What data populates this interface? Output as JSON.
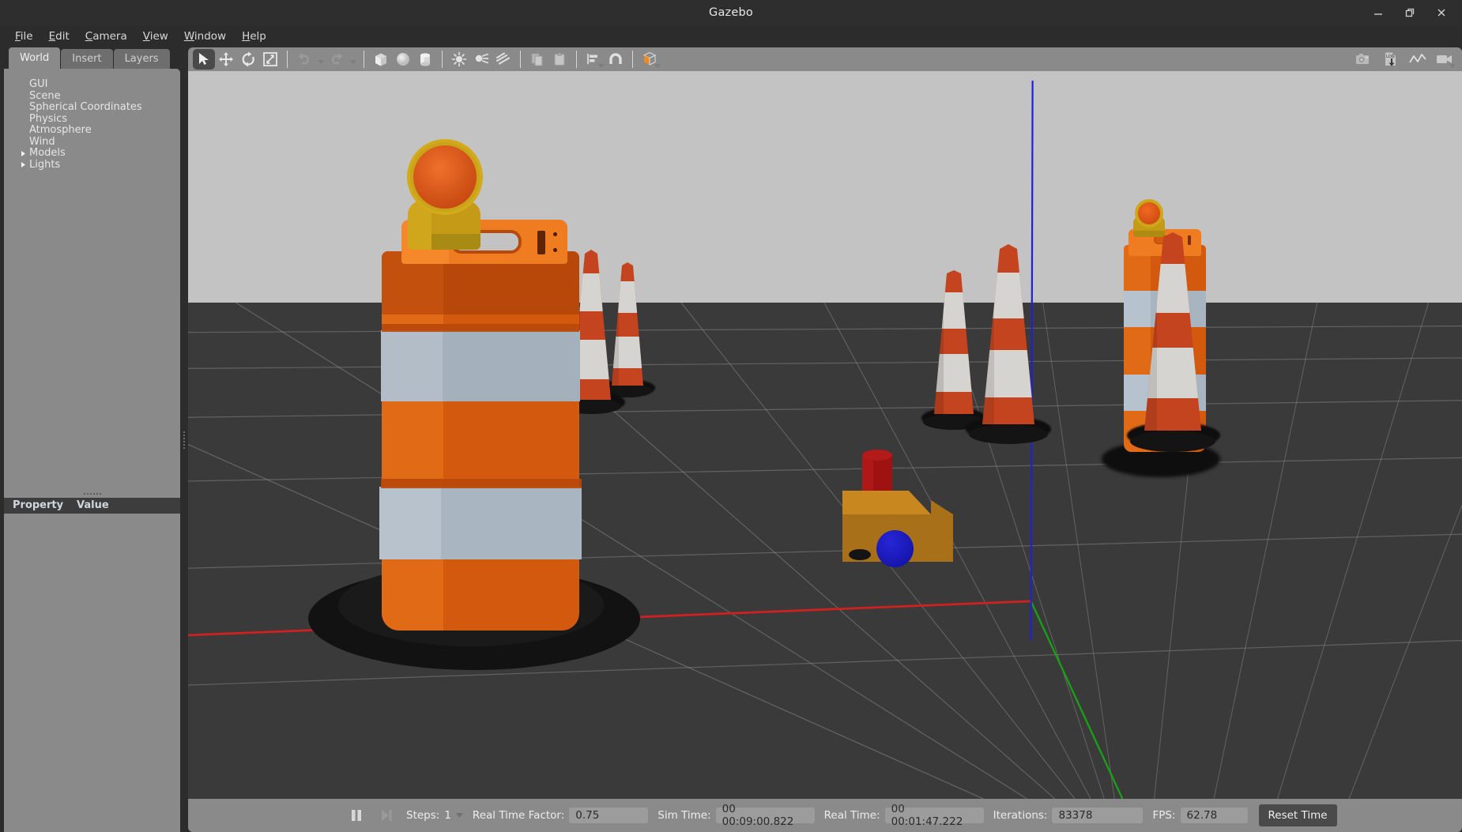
{
  "window": {
    "title": "Gazebo",
    "controls": [
      {
        "name": "minimize",
        "glyph": "minimize-icon"
      },
      {
        "name": "maximize",
        "glyph": "restore-icon"
      },
      {
        "name": "close",
        "glyph": "close-icon"
      }
    ]
  },
  "menubar": {
    "items": [
      {
        "label": "File",
        "mnemonic": "F"
      },
      {
        "label": "Edit",
        "mnemonic": "E"
      },
      {
        "label": "Camera",
        "mnemonic": "C"
      },
      {
        "label": "View",
        "mnemonic": "V"
      },
      {
        "label": "Window",
        "mnemonic": "W"
      },
      {
        "label": "Help",
        "mnemonic": "H"
      }
    ]
  },
  "left_panel": {
    "tabs": [
      {
        "label": "World",
        "active": true
      },
      {
        "label": "Insert",
        "active": false
      },
      {
        "label": "Layers",
        "active": false
      }
    ],
    "tree": [
      {
        "label": "GUI",
        "expandable": false
      },
      {
        "label": "Scene",
        "expandable": false
      },
      {
        "label": "Spherical Coordinates",
        "expandable": false
      },
      {
        "label": "Physics",
        "expandable": false
      },
      {
        "label": "Atmosphere",
        "expandable": false
      },
      {
        "label": "Wind",
        "expandable": false
      },
      {
        "label": "Models",
        "expandable": true
      },
      {
        "label": "Lights",
        "expandable": true
      }
    ],
    "property_table": {
      "col_property": "Property",
      "col_value": "Value",
      "rows": []
    }
  },
  "toolbar": {
    "left_tools": [
      {
        "name": "select-mode",
        "icon": "arrow-cursor-icon",
        "active": true
      },
      {
        "name": "translate-mode",
        "icon": "translate-arrows-icon",
        "active": false
      },
      {
        "name": "rotate-mode",
        "icon": "rotate-icon",
        "active": false
      },
      {
        "name": "scale-mode",
        "icon": "scale-icon",
        "active": false
      },
      {
        "name": "undo",
        "icon": "undo-arrow-icon",
        "active": false,
        "has_dropdown": true
      },
      {
        "name": "redo",
        "icon": "redo-arrow-icon",
        "active": false,
        "has_dropdown": true
      },
      {
        "name": "insert-box",
        "icon": "cube-icon",
        "active": false
      },
      {
        "name": "insert-sphere",
        "icon": "sphere-icon",
        "active": false
      },
      {
        "name": "insert-cylinder",
        "icon": "cylinder-icon",
        "active": false
      },
      {
        "name": "insert-point-light",
        "icon": "point-light-icon",
        "active": false
      },
      {
        "name": "insert-spot-light",
        "icon": "spot-light-icon",
        "active": false
      },
      {
        "name": "insert-directional-light",
        "icon": "directional-light-icon",
        "active": false
      },
      {
        "name": "copy",
        "icon": "copy-icon",
        "active": false
      },
      {
        "name": "paste",
        "icon": "paste-icon",
        "active": false
      },
      {
        "name": "align",
        "icon": "align-icon",
        "active": false,
        "has_dropdown": true
      },
      {
        "name": "snap",
        "icon": "magnet-icon",
        "active": false
      },
      {
        "name": "change-view-angle",
        "icon": "orange-cube-icon",
        "active": false,
        "has_dropdown": true
      }
    ],
    "right_tools": [
      {
        "name": "screenshot",
        "icon": "camera-icon"
      },
      {
        "name": "log-data",
        "icon": "log-download-icon"
      },
      {
        "name": "plot-window",
        "icon": "plot-line-icon"
      },
      {
        "name": "record-video",
        "icon": "video-camera-icon",
        "has_dropdown": true
      }
    ]
  },
  "status_bar": {
    "play_pause": {
      "name": "pause-button",
      "icon": "pause-icon"
    },
    "step": {
      "name": "step-button",
      "icon": "step-forward-icon"
    },
    "steps_label": "Steps:",
    "steps_value": "1",
    "rtf_label": "Real Time Factor:",
    "rtf_value": "0.75",
    "sim_time_label": "Sim Time:",
    "sim_time_value": "00 00:09:00.822",
    "real_time_label": "Real Time:",
    "real_time_value": "00 00:01:47.222",
    "iterations_label": "Iterations:",
    "iterations_value": "83378",
    "fps_label": "FPS:",
    "fps_value": "62.78",
    "reset_button": "Reset Time"
  },
  "viewport": {
    "name": "gazebo-3d-render-view",
    "sky_color": "#c3c3c3",
    "ground_color": "#3a3a3a",
    "grid_color": "#8f8f8f",
    "axes": {
      "x_axis_color": "#d02020",
      "y_axis_color": "#18a018",
      "z_axis_color": "#2020d8"
    },
    "materials": {
      "barrel_orange": "#d2590e",
      "barrel_orange_dark": "#b2460b",
      "barrel_stripe": "#a4b0bc",
      "cone_orange": "#c4441f",
      "cone_white": "#d8d6d2",
      "cone_base_black": "#121212",
      "light_housing_yellow": "#c49a16",
      "light_lens_orange": "#e0561a",
      "robot_body_orange": "#c8761a",
      "robot_cylinder_red": "#9e1212",
      "robot_sphere_blue": "#1414c0"
    },
    "objects": [
      {
        "name": "construction-barrel-foreground",
        "type": "barrel-with-warning-light"
      },
      {
        "name": "construction-barrel-right",
        "type": "barrel-with-warning-light"
      },
      {
        "name": "traffic-cone-left-a",
        "type": "cone"
      },
      {
        "name": "traffic-cone-left-b",
        "type": "cone"
      },
      {
        "name": "traffic-cone-right-a",
        "type": "cone"
      },
      {
        "name": "traffic-cone-right-b",
        "type": "cone"
      },
      {
        "name": "traffic-cone-right-c",
        "type": "cone"
      },
      {
        "name": "traffic-cone-right-d",
        "type": "cone"
      },
      {
        "name": "robot-model",
        "type": "box-cylinder-sphere-robot"
      }
    ]
  }
}
